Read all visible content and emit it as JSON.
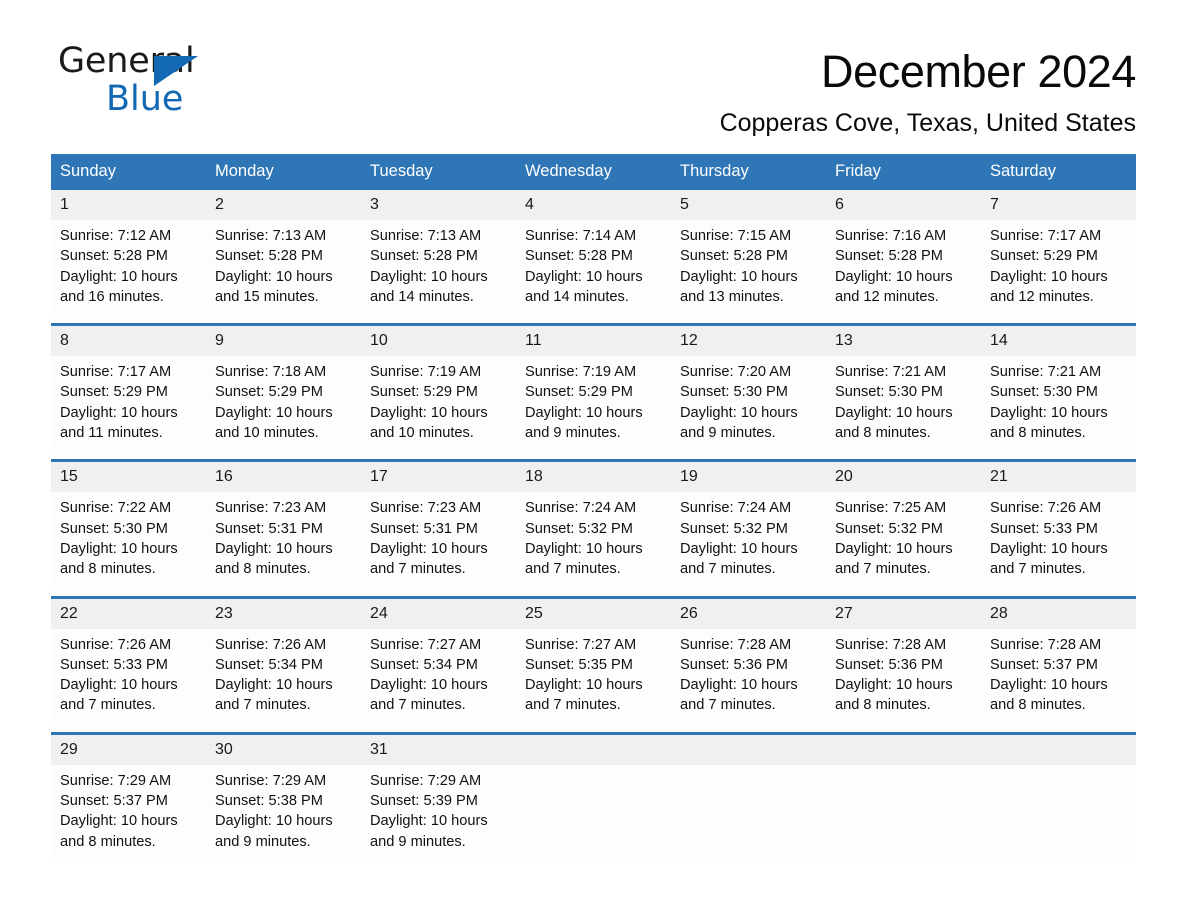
{
  "brand": {
    "name_top": "General",
    "name_bottom": "Blue",
    "accent_color": "#1268b3"
  },
  "header": {
    "title": "December 2024",
    "subtitle": "Copperas Cove, Texas, United States"
  },
  "calendar": {
    "header_color": "#2f76b6",
    "day_band_color": "#f0f0f0",
    "weekdays": [
      "Sunday",
      "Monday",
      "Tuesday",
      "Wednesday",
      "Thursday",
      "Friday",
      "Saturday"
    ],
    "weeks": [
      [
        {
          "date": "1",
          "sunrise": "Sunrise: 7:12 AM",
          "sunset": "Sunset: 5:28 PM",
          "daylight": "Daylight: 10 hours and 16 minutes."
        },
        {
          "date": "2",
          "sunrise": "Sunrise: 7:13 AM",
          "sunset": "Sunset: 5:28 PM",
          "daylight": "Daylight: 10 hours and 15 minutes."
        },
        {
          "date": "3",
          "sunrise": "Sunrise: 7:13 AM",
          "sunset": "Sunset: 5:28 PM",
          "daylight": "Daylight: 10 hours and 14 minutes."
        },
        {
          "date": "4",
          "sunrise": "Sunrise: 7:14 AM",
          "sunset": "Sunset: 5:28 PM",
          "daylight": "Daylight: 10 hours and 14 minutes."
        },
        {
          "date": "5",
          "sunrise": "Sunrise: 7:15 AM",
          "sunset": "Sunset: 5:28 PM",
          "daylight": "Daylight: 10 hours and 13 minutes."
        },
        {
          "date": "6",
          "sunrise": "Sunrise: 7:16 AM",
          "sunset": "Sunset: 5:28 PM",
          "daylight": "Daylight: 10 hours and 12 minutes."
        },
        {
          "date": "7",
          "sunrise": "Sunrise: 7:17 AM",
          "sunset": "Sunset: 5:29 PM",
          "daylight": "Daylight: 10 hours and 12 minutes."
        }
      ],
      [
        {
          "date": "8",
          "sunrise": "Sunrise: 7:17 AM",
          "sunset": "Sunset: 5:29 PM",
          "daylight": "Daylight: 10 hours and 11 minutes."
        },
        {
          "date": "9",
          "sunrise": "Sunrise: 7:18 AM",
          "sunset": "Sunset: 5:29 PM",
          "daylight": "Daylight: 10 hours and 10 minutes."
        },
        {
          "date": "10",
          "sunrise": "Sunrise: 7:19 AM",
          "sunset": "Sunset: 5:29 PM",
          "daylight": "Daylight: 10 hours and 10 minutes."
        },
        {
          "date": "11",
          "sunrise": "Sunrise: 7:19 AM",
          "sunset": "Sunset: 5:29 PM",
          "daylight": "Daylight: 10 hours and 9 minutes."
        },
        {
          "date": "12",
          "sunrise": "Sunrise: 7:20 AM",
          "sunset": "Sunset: 5:30 PM",
          "daylight": "Daylight: 10 hours and 9 minutes."
        },
        {
          "date": "13",
          "sunrise": "Sunrise: 7:21 AM",
          "sunset": "Sunset: 5:30 PM",
          "daylight": "Daylight: 10 hours and 8 minutes."
        },
        {
          "date": "14",
          "sunrise": "Sunrise: 7:21 AM",
          "sunset": "Sunset: 5:30 PM",
          "daylight": "Daylight: 10 hours and 8 minutes."
        }
      ],
      [
        {
          "date": "15",
          "sunrise": "Sunrise: 7:22 AM",
          "sunset": "Sunset: 5:30 PM",
          "daylight": "Daylight: 10 hours and 8 minutes."
        },
        {
          "date": "16",
          "sunrise": "Sunrise: 7:23 AM",
          "sunset": "Sunset: 5:31 PM",
          "daylight": "Daylight: 10 hours and 8 minutes."
        },
        {
          "date": "17",
          "sunrise": "Sunrise: 7:23 AM",
          "sunset": "Sunset: 5:31 PM",
          "daylight": "Daylight: 10 hours and 7 minutes."
        },
        {
          "date": "18",
          "sunrise": "Sunrise: 7:24 AM",
          "sunset": "Sunset: 5:32 PM",
          "daylight": "Daylight: 10 hours and 7 minutes."
        },
        {
          "date": "19",
          "sunrise": "Sunrise: 7:24 AM",
          "sunset": "Sunset: 5:32 PM",
          "daylight": "Daylight: 10 hours and 7 minutes."
        },
        {
          "date": "20",
          "sunrise": "Sunrise: 7:25 AM",
          "sunset": "Sunset: 5:32 PM",
          "daylight": "Daylight: 10 hours and 7 minutes."
        },
        {
          "date": "21",
          "sunrise": "Sunrise: 7:26 AM",
          "sunset": "Sunset: 5:33 PM",
          "daylight": "Daylight: 10 hours and 7 minutes."
        }
      ],
      [
        {
          "date": "22",
          "sunrise": "Sunrise: 7:26 AM",
          "sunset": "Sunset: 5:33 PM",
          "daylight": "Daylight: 10 hours and 7 minutes."
        },
        {
          "date": "23",
          "sunrise": "Sunrise: 7:26 AM",
          "sunset": "Sunset: 5:34 PM",
          "daylight": "Daylight: 10 hours and 7 minutes."
        },
        {
          "date": "24",
          "sunrise": "Sunrise: 7:27 AM",
          "sunset": "Sunset: 5:34 PM",
          "daylight": "Daylight: 10 hours and 7 minutes."
        },
        {
          "date": "25",
          "sunrise": "Sunrise: 7:27 AM",
          "sunset": "Sunset: 5:35 PM",
          "daylight": "Daylight: 10 hours and 7 minutes."
        },
        {
          "date": "26",
          "sunrise": "Sunrise: 7:28 AM",
          "sunset": "Sunset: 5:36 PM",
          "daylight": "Daylight: 10 hours and 7 minutes."
        },
        {
          "date": "27",
          "sunrise": "Sunrise: 7:28 AM",
          "sunset": "Sunset: 5:36 PM",
          "daylight": "Daylight: 10 hours and 8 minutes."
        },
        {
          "date": "28",
          "sunrise": "Sunrise: 7:28 AM",
          "sunset": "Sunset: 5:37 PM",
          "daylight": "Daylight: 10 hours and 8 minutes."
        }
      ],
      [
        {
          "date": "29",
          "sunrise": "Sunrise: 7:29 AM",
          "sunset": "Sunset: 5:37 PM",
          "daylight": "Daylight: 10 hours and 8 minutes."
        },
        {
          "date": "30",
          "sunrise": "Sunrise: 7:29 AM",
          "sunset": "Sunset: 5:38 PM",
          "daylight": "Daylight: 10 hours and 9 minutes."
        },
        {
          "date": "31",
          "sunrise": "Sunrise: 7:29 AM",
          "sunset": "Sunset: 5:39 PM",
          "daylight": "Daylight: 10 hours and 9 minutes."
        },
        {
          "date": "",
          "sunrise": "",
          "sunset": "",
          "daylight": ""
        },
        {
          "date": "",
          "sunrise": "",
          "sunset": "",
          "daylight": ""
        },
        {
          "date": "",
          "sunrise": "",
          "sunset": "",
          "daylight": ""
        },
        {
          "date": "",
          "sunrise": "",
          "sunset": "",
          "daylight": ""
        }
      ]
    ]
  }
}
